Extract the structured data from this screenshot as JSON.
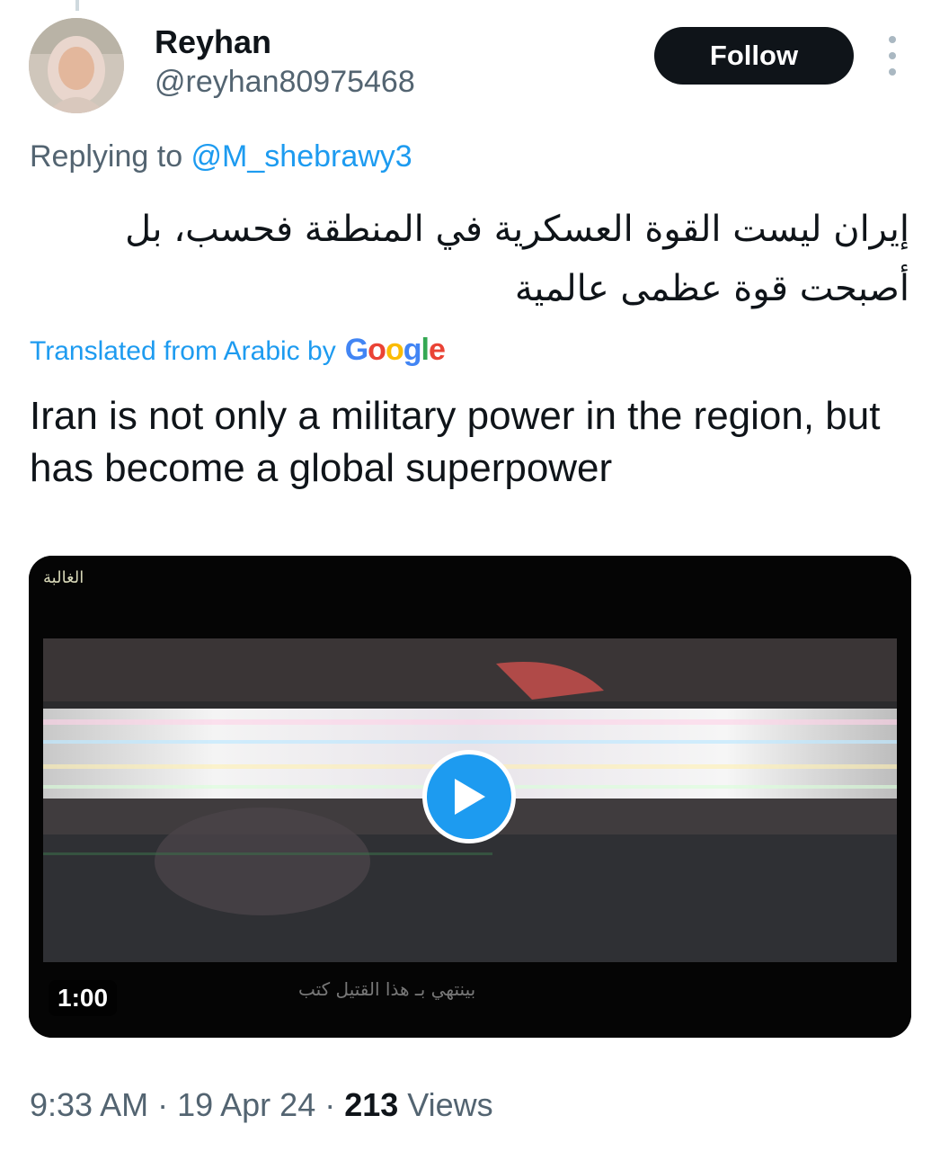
{
  "user": {
    "name": "Reyhan",
    "handle": "@reyhan80975468"
  },
  "actions": {
    "follow_label": "Follow"
  },
  "reply": {
    "prefix": "Replying to ",
    "mention": "@M_shebrawy3"
  },
  "tweet": {
    "original_text": "إيران ليست القوة العسكرية في المنطقة فحسب، بل أصبحت قوة عظمى عالمية",
    "translated_from": "Translated from Arabic by",
    "translator_brand": [
      "G",
      "o",
      "o",
      "g",
      "l",
      "e"
    ],
    "translation": "Iran is not only a military power in the region, but has become a global superpower"
  },
  "video": {
    "channel_logo_text": "الغالبة",
    "duration": "1:00",
    "subtitle_text": "بينتهي بـ هذا القتيل كتب"
  },
  "meta": {
    "time": "9:33 AM",
    "separator": " · ",
    "date": "19 Apr 24",
    "views_count": "213",
    "views_label": " Views"
  }
}
